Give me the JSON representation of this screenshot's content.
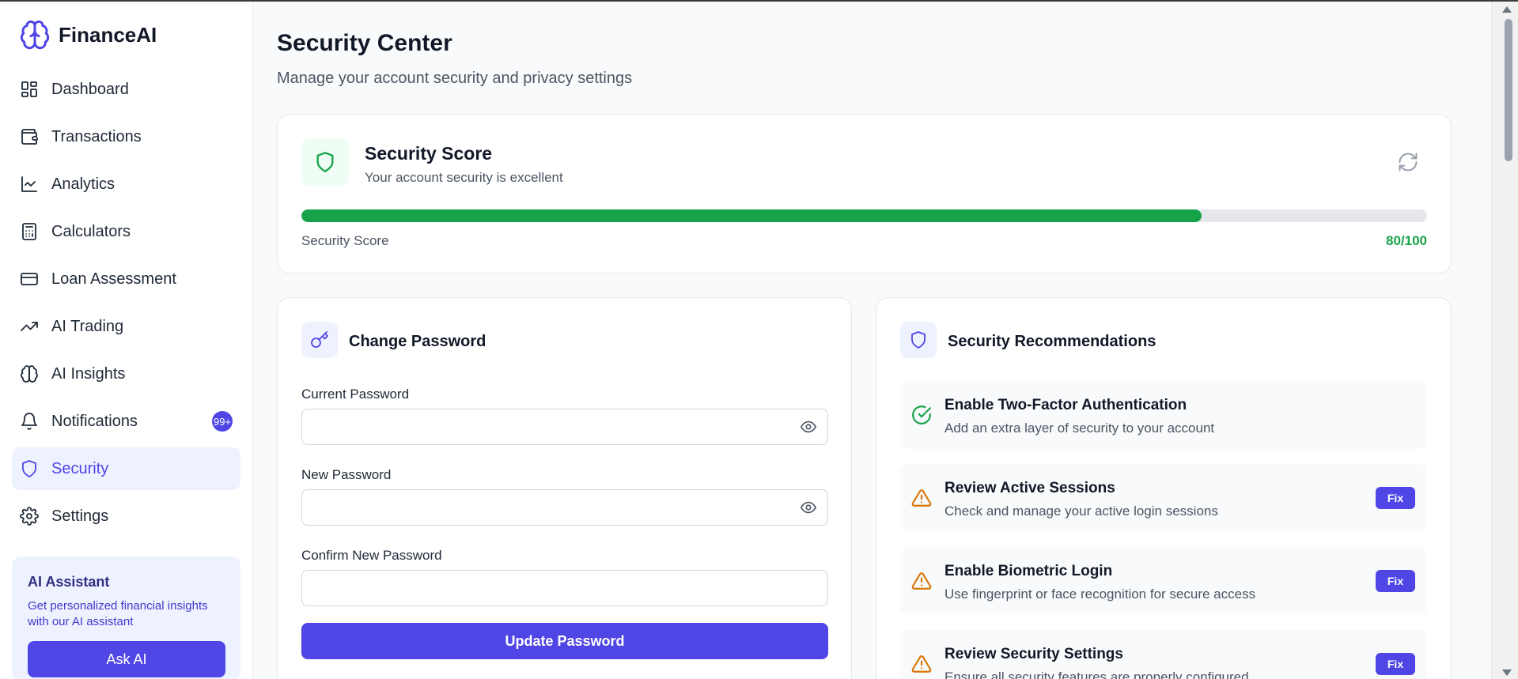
{
  "app": {
    "name": "FinanceAI"
  },
  "sidebar": {
    "items": [
      {
        "label": "Dashboard",
        "icon": "dashboard-icon"
      },
      {
        "label": "Transactions",
        "icon": "wallet-icon"
      },
      {
        "label": "Analytics",
        "icon": "line-chart-icon"
      },
      {
        "label": "Calculators",
        "icon": "calculator-icon"
      },
      {
        "label": "Loan Assessment",
        "icon": "credit-card-icon"
      },
      {
        "label": "AI Trading",
        "icon": "trending-up-icon"
      },
      {
        "label": "AI Insights",
        "icon": "brain-icon"
      },
      {
        "label": "Notifications",
        "icon": "bell-icon",
        "badge": "99+"
      },
      {
        "label": "Security",
        "icon": "shield-icon",
        "active": true
      },
      {
        "label": "Settings",
        "icon": "gear-icon"
      }
    ],
    "ai_box": {
      "title": "AI Assistant",
      "description": "Get personalized financial insights with our AI assistant",
      "button": "Ask AI"
    }
  },
  "page": {
    "title": "Security Center",
    "subtitle": "Manage your account security and privacy settings"
  },
  "score": {
    "title": "Security Score",
    "description": "Your account security is excellent",
    "bar_label": "Security Score",
    "value_text": "80/100",
    "progress": 0.8
  },
  "password": {
    "title": "Change Password",
    "current_label": "Current Password",
    "new_label": "New Password",
    "confirm_label": "Confirm New Password",
    "current_value": "",
    "new_value": "",
    "confirm_value": "",
    "button": "Update Password"
  },
  "recommendations": {
    "title": "Security Recommendations",
    "items": [
      {
        "title": "Enable Two-Factor Authentication",
        "description": "Add an extra layer of security to your account",
        "status": "done"
      },
      {
        "title": "Review Active Sessions",
        "description": "Check and manage your active login sessions",
        "status": "warning",
        "action": "Fix"
      },
      {
        "title": "Enable Biometric Login",
        "description": "Use fingerprint or face recognition for secure access",
        "status": "warning",
        "action": "Fix"
      },
      {
        "title": "Review Security Settings",
        "description": "Ensure all security features are properly configured",
        "status": "warning",
        "action": "Fix"
      }
    ]
  },
  "colors": {
    "accent": "#4f46e5",
    "success": "#16a34a",
    "warning": "#d97706"
  }
}
